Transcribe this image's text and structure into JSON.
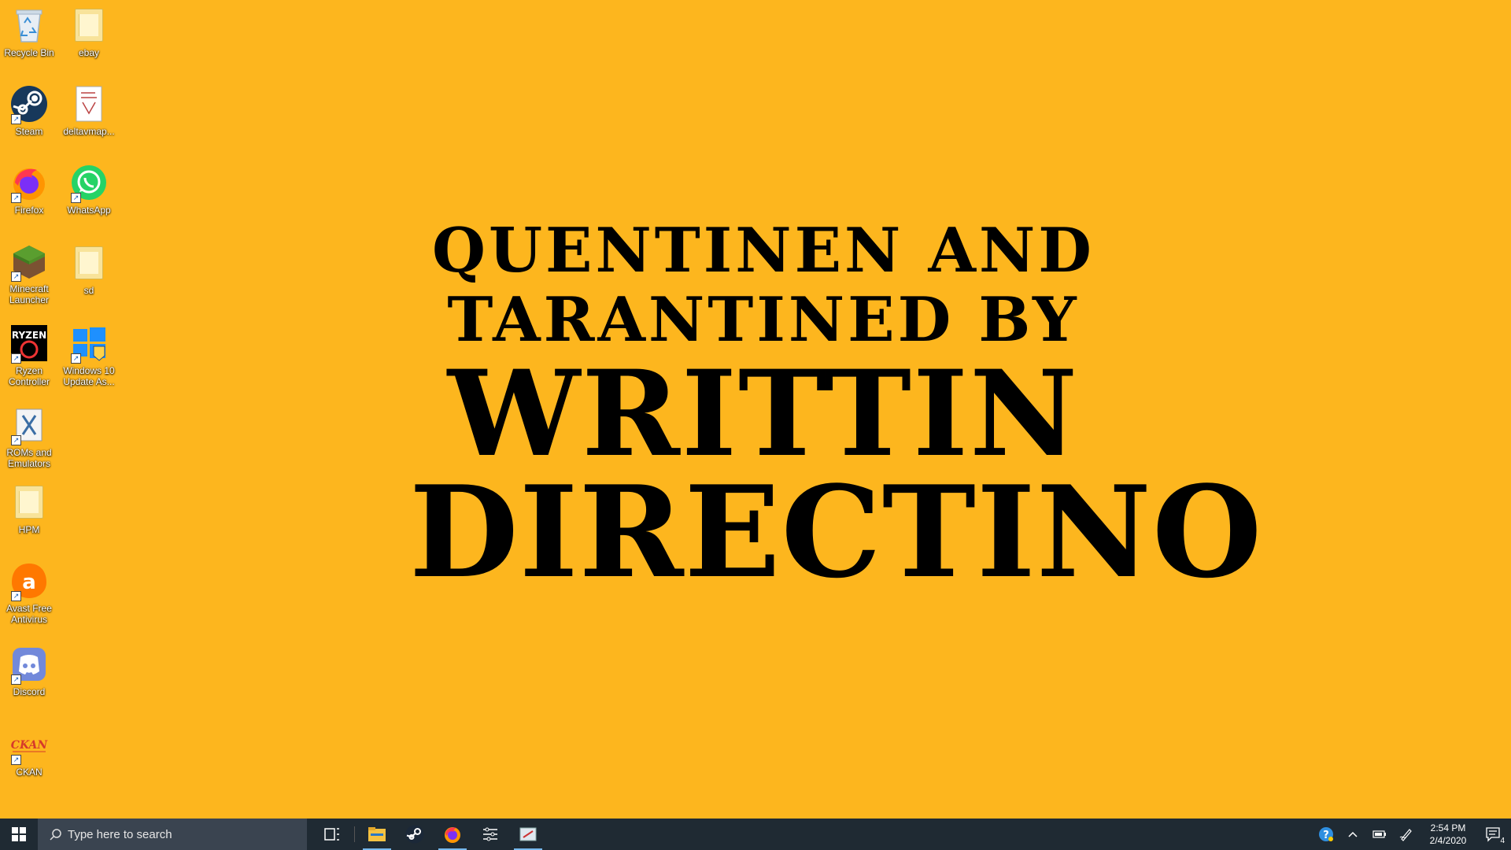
{
  "desktop": {
    "background_color": "#FDB61E",
    "icons": [
      {
        "label": "Recycle Bin",
        "icon": "recycle-bin-icon"
      },
      {
        "label": "ebay",
        "icon": "folder-icon"
      },
      {
        "label": "Steam",
        "icon": "steam-icon"
      },
      {
        "label": "deltavmap...",
        "icon": "document-icon"
      },
      {
        "label": "Firefox",
        "icon": "firefox-icon"
      },
      {
        "label": "WhatsApp",
        "icon": "whatsapp-icon"
      },
      {
        "label": "Minecraft Launcher",
        "icon": "minecraft-icon"
      },
      {
        "label": "sd",
        "icon": "folder-icon"
      },
      {
        "label": "Ryzen Controller",
        "icon": "ryzen-icon"
      },
      {
        "label": "Windows 10 Update As...",
        "icon": "windows-update-icon"
      },
      {
        "label": "ROMs and Emulators",
        "icon": "roms-icon"
      },
      {
        "label": "HPM",
        "icon": "folder-icon"
      },
      {
        "label": "Avast Free Antivirus",
        "icon": "avast-icon"
      },
      {
        "label": "Discord",
        "icon": "discord-icon"
      },
      {
        "label": "CKAN",
        "icon": "ckan-icon"
      }
    ]
  },
  "wallpaper": {
    "line1": "QUENTINEN AND",
    "line2": "TARANTINED BY",
    "line3": "WRITTIN",
    "line4": "DIRECTINO"
  },
  "taskbar": {
    "search_placeholder": "Type here to search",
    "pinned": [
      "task-view-icon",
      "file-explorer-icon",
      "steam-icon",
      "firefox-icon",
      "settings-icon",
      "snipping-icon"
    ],
    "clock_time": "2:54 PM",
    "clock_date": "2/4/2020",
    "notification_count": "4"
  }
}
